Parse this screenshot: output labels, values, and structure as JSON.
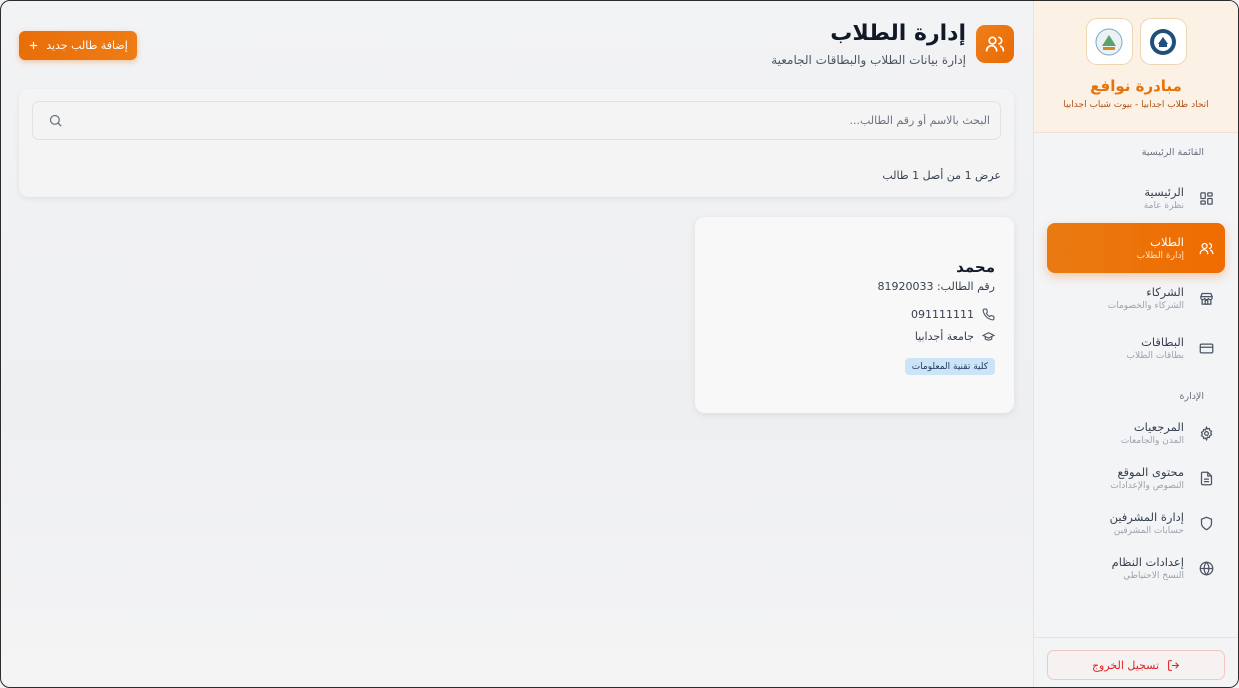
{
  "brand": {
    "title": "مبادرة نوافع",
    "subtitle": "اتحاد طلاب اجدابيا - بيوت شباب اجدابيا"
  },
  "sidebar": {
    "main_section": "القائمة الرئيسية",
    "admin_section": "الإدارة",
    "main_items": [
      {
        "label": "الرئيسية",
        "sub": "نظرة عامة",
        "icon": "dashboard-icon"
      },
      {
        "label": "الطلاب",
        "sub": "إدارة الطلاب",
        "icon": "users-icon",
        "active": true
      },
      {
        "label": "الشركاء",
        "sub": "الشركاء والخصومات",
        "icon": "store-icon"
      },
      {
        "label": "البطاقات",
        "sub": "بطاقات الطلاب",
        "icon": "card-icon"
      }
    ],
    "admin_items": [
      {
        "label": "المرجعيات",
        "sub": "المدن والجامعات",
        "icon": "gear-icon"
      },
      {
        "label": "محتوى الموقع",
        "sub": "النصوص والإعدادات",
        "icon": "document-icon"
      },
      {
        "label": "إدارة المشرفين",
        "sub": "حسابات المشرفين",
        "icon": "shield-icon"
      },
      {
        "label": "إعدادات النظام",
        "sub": "النسخ الاحتياطي",
        "icon": "globe-icon"
      }
    ],
    "logout_label": "تسجيل الخروج"
  },
  "header": {
    "title": "إدارة الطلاب",
    "subtitle": "إدارة بيانات الطلاب والبطاقات الجامعية",
    "add_button": "إضافة طالب جديد"
  },
  "search": {
    "placeholder": "البحث بالاسم أو رقم الطالب...",
    "value": "",
    "count_text": "عرض 1 من أصل 1 طالب"
  },
  "students": [
    {
      "name": "محمد",
      "id_text": "رقم الطالب: 81920033",
      "phone": "091111111",
      "university": "جامعة أجدابيا",
      "faculty": "كلية تقنية المعلومات"
    }
  ],
  "colors": {
    "accent": "#ef6c00",
    "brand_title": "#e8720a",
    "badge_bg": "#cde3f7",
    "logout": "#dc2626"
  }
}
